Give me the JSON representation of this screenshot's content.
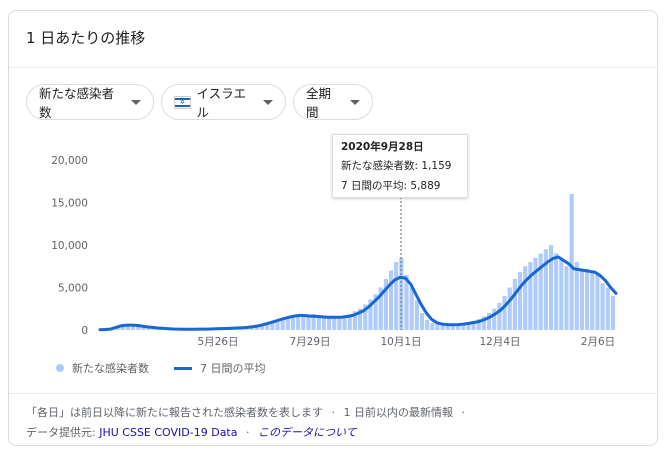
{
  "title": "1 日あたりの推移",
  "filters": {
    "metric": "新たな感染者数",
    "country": "イスラエル",
    "period": "全期間"
  },
  "tooltip": {
    "date": "2020年9月28日",
    "cases": "新たな感染者数: 1,159",
    "avg": "7 日間の平均: 5,889"
  },
  "legend": {
    "bars": "新たな感染者数",
    "line": "7 日間の平均"
  },
  "footer": {
    "note": "「各日」は前日以降に新たに報告された感染者数を表します",
    "sep1": "·",
    "info": "1 日前以内の最新情報",
    "sep2": "·",
    "provider_label": "データ提供元:",
    "provider": "JHU CSSE COVID-19 Data",
    "sep3": "·",
    "about": "このデータについて"
  },
  "colors": {
    "bar": "#aecbfa",
    "line": "#1967d2"
  },
  "chart_data": {
    "type": "bar",
    "title": "",
    "ylim": [
      0,
      20000
    ],
    "yticks": [
      "20,000",
      "15,000",
      "10,000",
      "5,000",
      "0"
    ],
    "xticks": [
      "5月26日",
      "7月29日",
      "10月1日",
      "12月4日",
      "2月6日"
    ],
    "series": [
      {
        "name": "新たな感染者数",
        "kind": "bar",
        "values": [
          50,
          80,
          100,
          400,
          600,
          500,
          700,
          500,
          300,
          250,
          200,
          150,
          120,
          100,
          80,
          60,
          50,
          40,
          40,
          50,
          60,
          70,
          80,
          90,
          100,
          110,
          130,
          150,
          200,
          250,
          350,
          500,
          700,
          900,
          1100,
          1300,
          1500,
          1700,
          1900,
          1800,
          1700,
          1900,
          1700,
          1500,
          1400,
          1600,
          1500,
          1700,
          1800,
          2200,
          2500,
          3000,
          3600,
          4200,
          5000,
          6000,
          7000,
          8000,
          8500,
          6500,
          5000,
          3500,
          2000,
          1200,
          800,
          700,
          650,
          600,
          650,
          700,
          800,
          900,
          1000,
          1300,
          1600,
          2000,
          2500,
          3200,
          4000,
          5000,
          6000,
          6800,
          7500,
          8000,
          8500,
          9000,
          9500,
          10000,
          9000,
          8500,
          7500,
          16000,
          8000,
          7000,
          7200,
          6800,
          6500,
          5500,
          5000,
          4000
        ]
      },
      {
        "name": "7 日間の平均",
        "kind": "line",
        "values": [
          30,
          60,
          100,
          300,
          500,
          560,
          580,
          540,
          460,
          370,
          300,
          240,
          190,
          150,
          120,
          100,
          90,
          90,
          90,
          100,
          110,
          120,
          140,
          160,
          180,
          200,
          230,
          260,
          300,
          380,
          480,
          620,
          800,
          980,
          1180,
          1360,
          1520,
          1650,
          1720,
          1700,
          1640,
          1600,
          1560,
          1520,
          1500,
          1500,
          1520,
          1600,
          1720,
          1950,
          2250,
          2700,
          3300,
          3900,
          4600,
          5300,
          5900,
          6200,
          6100,
          5400,
          4200,
          3000,
          2000,
          1250,
          850,
          700,
          640,
          620,
          640,
          690,
          780,
          880,
          1000,
          1220,
          1500,
          1860,
          2300,
          2900,
          3600,
          4400,
          5200,
          5900,
          6500,
          7000,
          7500,
          8000,
          8400,
          8600,
          8200,
          7800,
          7200,
          7100,
          7000,
          6900,
          6800,
          6400,
          5800,
          5000,
          4300
        ]
      }
    ],
    "grid": false
  }
}
